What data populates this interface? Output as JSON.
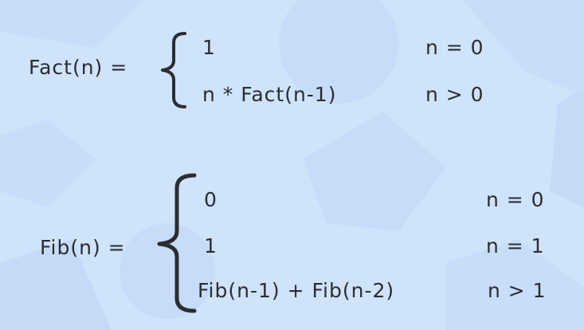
{
  "background": {
    "color": "#cfe3fb",
    "shape_color": "#c4daf7"
  },
  "text_color": "#2b2d33",
  "factorial": {
    "lhs": "Fact(n) =",
    "cases": [
      {
        "expr": "1",
        "cond": "n = 0"
      },
      {
        "expr": "n * Fact(n-1)",
        "cond": "n > 0"
      }
    ]
  },
  "fibonacci": {
    "lhs": "Fib(n) =",
    "cases": [
      {
        "expr": "0",
        "cond": "n = 0"
      },
      {
        "expr": "1",
        "cond": "n = 1"
      },
      {
        "expr": "Fib(n-1) + Fib(n-2)",
        "cond": "n > 1"
      }
    ]
  }
}
